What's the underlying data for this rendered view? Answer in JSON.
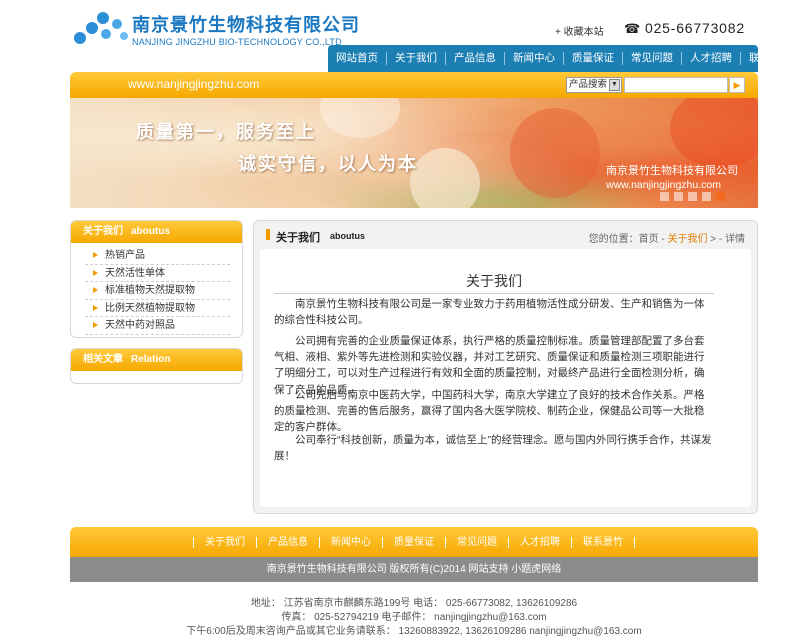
{
  "header": {
    "company_cn": "南京景竹生物科技有限公司",
    "company_en": "NANJING JINGZHU BIO-TECHNOLOGY CO.,LTD",
    "favorite": "+ 收藏本站",
    "phone": "025-66773082"
  },
  "nav": [
    "网站首页",
    "关于我们",
    "产品信息",
    "新闻中心",
    "质量保证",
    "常见问题",
    "人才招聘",
    "联系景竹"
  ],
  "banner": {
    "url": "www.nanjingjingzhu.com",
    "search_select": "产品搜索",
    "search_button": "▶",
    "slogan1": "质量第一，服务至上",
    "slogan2": "诚实守信，以人为本",
    "company": "南京景竹生物科技有限公司",
    "company_url": "www.nanjingjingzhu.com",
    "slide_count": 5,
    "active_slide": 5
  },
  "sidebar": {
    "about_title": "关于我们",
    "about_title_en": "aboutus",
    "items": [
      "热销产品",
      "天然活性单体",
      "标准植物天然提取物",
      "比例天然植物提取物",
      "天然中药对照品"
    ],
    "related_title": "相关文章",
    "related_title_en": "Relation"
  },
  "main": {
    "title": "关于我们",
    "title_en": "aboutus",
    "breadcrumb_prefix": "您的位置：",
    "breadcrumb_home": "首页",
    "breadcrumb_sep1": " - ",
    "breadcrumb_current": "关于我们",
    "breadcrumb_sep2": " > - ",
    "breadcrumb_detail": "详情",
    "article_title": "关于我们",
    "paragraphs": [
      "南京景竹生物科技有限公司是一家专业致力于药用植物活性成分研发、生产和销售为一体的综合性科技公司。",
      "公司拥有完善的企业质量保证体系，执行严格的质量控制标准。质量管理部配置了多台套气相、液相、紫外等先进检测和实验仪器，并对工艺研究、质量保证和质量检测三项职能进行了明细分工，可以对生产过程进行有效和全面的质量控制，对最终产品进行全面检测分析，确保了产品的品质。",
      "公司先后与南京中医药大学，中国药科大学，南京大学建立了良好的技术合作关系。严格的质量检测、完善的售后服务，赢得了国内各大医学院校、制药企业，保健品公司等一大批稳定的客户群体。",
      "公司奉行“科技创新，质量为本，诚信至上”的经营理念。愿与国内外同行携手合作，共谋发展！"
    ]
  },
  "footer": {
    "links": [
      "关于我们",
      "产品信息",
      "新闻中心",
      "质量保证",
      "常见问题",
      "人才招聘",
      "联系景竹"
    ],
    "copyright": "南京景竹生物科技有限公司 版权所有(C)2014 网站支持 小题虎网络",
    "address_line": "地址：  江苏省南京市麒麟东路199号    电话：  025-66773082, 13626109286",
    "fax_line": "传真：  025-52794219    电子邮件：  nanjingjingzhu@163.com",
    "hours_line": "下午6:00后及周末咨询产品或其它业务请联系：  13260883922, 13626109286 nanjingjingzhu@163.com"
  },
  "colors": {
    "brand_blue": "#1a78c2",
    "nav_blue": "#1b7fb4",
    "accent_orange": "#f6a800",
    "footer_gray": "#8c8c8c"
  }
}
